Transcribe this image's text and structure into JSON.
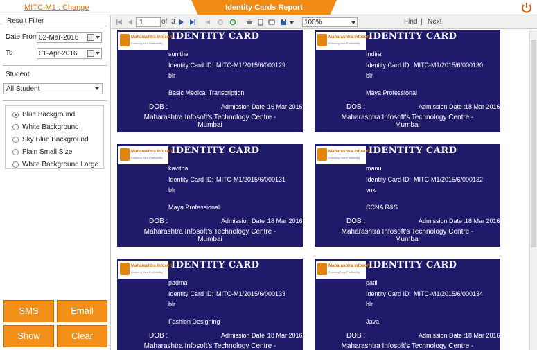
{
  "header": {
    "centre_link": "MITC-M1 : Change",
    "title": "Identity Cards Report"
  },
  "filter": {
    "title": "Result Filter",
    "date_from_label": "Date From",
    "date_from": "02-Mar-2016",
    "to_label": "To",
    "to": "01-Apr-2016",
    "student_label": "Student",
    "student_value": "All Student",
    "backgrounds": [
      "Blue Background",
      "White Background",
      "Sky Blue Background",
      "Plain Small Size",
      "White Background Large"
    ],
    "selected": "Blue Background"
  },
  "buttons": {
    "sms": "SMS",
    "email": "Email",
    "show": "Show",
    "clear": "Clear"
  },
  "toolbar": {
    "page": "1",
    "of": "of",
    "total": "3",
    "zoom": "100%",
    "find": "Find",
    "separator": "|",
    "next": "Next"
  },
  "card_labels": {
    "title": "IDENTITY CARD",
    "id_label": "Identity Card ID:",
    "dob_label": "DOB :",
    "admission_label": "Admission Date :",
    "centre_line1": "Maharashtra Infosoft's Technology Centre -",
    "centre_line2": "Mumbai",
    "logo_name": "Maharashtra Infosoft",
    "logo_tagline": "Ensuring Your Profitability"
  },
  "cards": [
    {
      "name": "sunitha",
      "id": "MITC-M1/2015/6/000129",
      "branch": "blr",
      "course": "Basic Medical Transcription",
      "admission": "16 Mar 2016"
    },
    {
      "name": "Indira",
      "id": "MITC-M1/2015/6/000130",
      "branch": "blr",
      "course": "Maya Professional",
      "admission": "18 Mar 2016"
    },
    {
      "name": "kavitha",
      "id": "MITC-M1/2015/6/000131",
      "branch": "blr",
      "course": "Maya Professional",
      "admission": "18 Mar 2016"
    },
    {
      "name": "manu",
      "id": "MITC-M1/2015/6/000132",
      "branch": "ynk",
      "course": "CCNA R&S",
      "admission": "18 Mar 2016"
    },
    {
      "name": "padma",
      "id": "MITC-M1/2015/6/000133",
      "branch": "blr",
      "course": "Fashion Designing",
      "admission": "18 Mar 2016"
    },
    {
      "name": "patil",
      "id": "MITC-M1/2015/6/000134",
      "branch": "blr",
      "course": "Java",
      "admission": "18 Mar 2016"
    }
  ],
  "colors": {
    "accent": "#f39019",
    "card": "#201a6b"
  }
}
